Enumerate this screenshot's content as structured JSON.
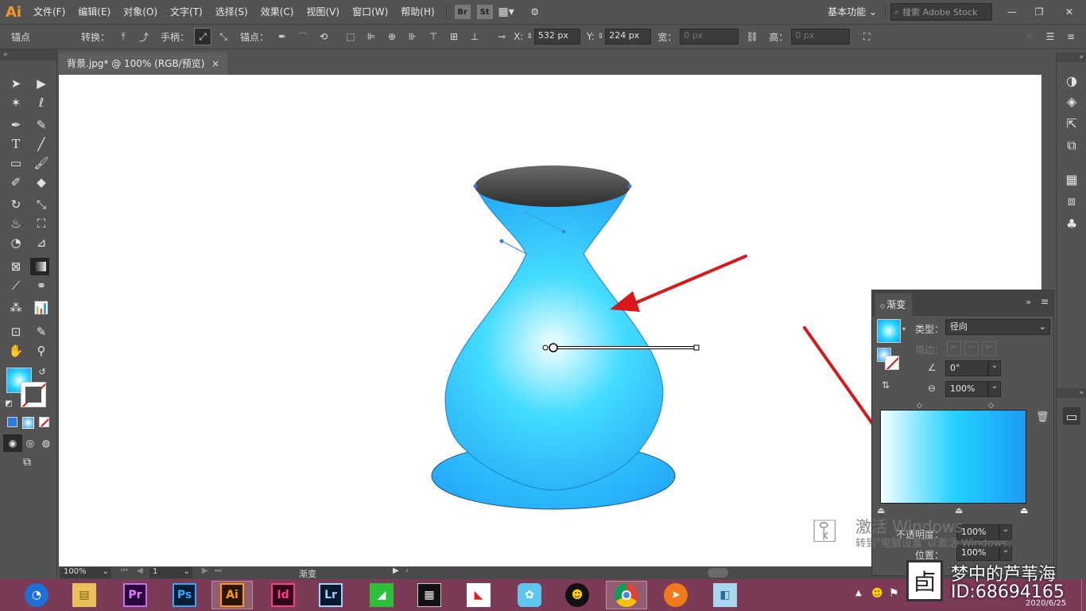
{
  "app": {
    "logo": "Ai"
  },
  "menu": [
    "文件(F)",
    "编辑(E)",
    "对象(O)",
    "文字(T)",
    "选择(S)",
    "效果(C)",
    "视图(V)",
    "窗口(W)",
    "帮助(H)"
  ],
  "menubar_apps": {
    "br": "Br",
    "st": "St"
  },
  "workspace": {
    "label": "基本功能",
    "search_placeholder": "搜索 Adobe Stock"
  },
  "control": {
    "anchor_label": "锚点",
    "convert_label": "转换：",
    "handle_label": "手柄：",
    "anchor_points_label": "锚点：",
    "x_label": "X:",
    "x_value": "532 px",
    "y_label": "Y:",
    "y_value": "224 px",
    "w_label": "宽：",
    "w_value": "0 px",
    "h_label": "高：",
    "h_value": "0 px"
  },
  "document": {
    "tab_title": "背景.jpg* @ 100% (RGB/预览)",
    "close": "×"
  },
  "status": {
    "zoom": "100%",
    "artboard": "1",
    "tool_name": "渐变"
  },
  "gradient_panel": {
    "title": "渐变",
    "type_label": "类型：",
    "type_value": "径向",
    "stroke_label": "描边：",
    "angle_value": "0°",
    "aspect_value": "100%",
    "opacity_label": "不透明度：",
    "opacity_value": "100%",
    "location_label": "位置：",
    "location_value": "100%",
    "start_color": "#f2ffff",
    "mid_color": "#22d2ff",
    "end_color": "#1a9cf5"
  },
  "colors": {
    "fill_center": "#e9ffff",
    "fill_edge": "#1aa6f5",
    "vase_dark": "#2a5fb8",
    "neck_top": "#4a4a4a",
    "arrow": "#e01b1b"
  },
  "watermark": {
    "title": "激活 Windows",
    "subtitle": "转到\"电脑设置\"以激活 Windows。"
  },
  "overlay_caption": {
    "line1": "梦中的芦苇海",
    "line2": "ID:68694165",
    "date": "2020/6/25"
  },
  "taskbar_apps": [
    {
      "name": "start",
      "label": ""
    },
    {
      "name": "explorer",
      "label": ""
    },
    {
      "name": "premiere",
      "label": "Pr"
    },
    {
      "name": "photoshop",
      "label": "Ps"
    },
    {
      "name": "illustrator",
      "label": "Ai"
    },
    {
      "name": "indesign",
      "label": "Id"
    },
    {
      "name": "lightroom",
      "label": "Lr"
    },
    {
      "name": "app-green",
      "label": ""
    },
    {
      "name": "video-editor",
      "label": ""
    },
    {
      "name": "app-red",
      "label": ""
    },
    {
      "name": "app-bird",
      "label": ""
    },
    {
      "name": "qq",
      "label": ""
    },
    {
      "name": "chrome",
      "label": ""
    },
    {
      "name": "app-orange",
      "label": ""
    },
    {
      "name": "app-blue",
      "label": ""
    }
  ]
}
